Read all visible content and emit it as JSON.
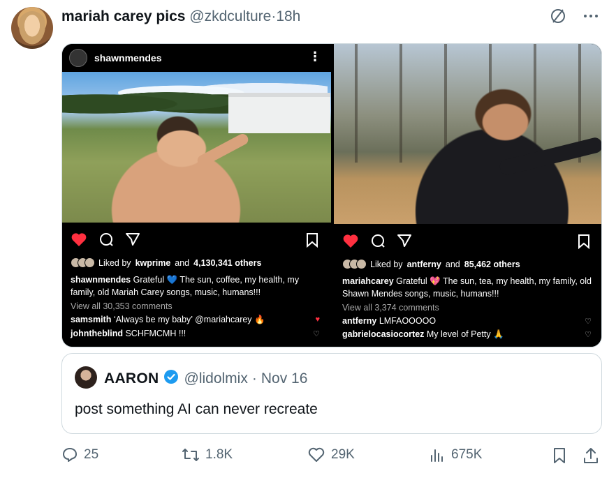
{
  "tweet": {
    "author_name": "mariah carey pics",
    "author_handle": "@zkdculture",
    "separator": "·",
    "time": "18h"
  },
  "left_post": {
    "username": "shawnmendes",
    "likes_prefix": "Liked by",
    "liked_by": "kwprime",
    "likes_mid": "and",
    "likes_count": "4,130,341 others",
    "caption_user": "shawnmendes",
    "caption_text_1": "Grateful",
    "caption_heart": "💙",
    "caption_text_2": "The sun, coffee, my health, my family, old Mariah Carey songs, music, humans!!!",
    "view_all": "View all 30,353 comments",
    "comments": [
      {
        "user": "samsmith",
        "text": "‘Always be my baby’ @mariahcarey 🔥"
      },
      {
        "user": "johntheblind",
        "text": "SCHFMCMH !!!"
      }
    ]
  },
  "right_post": {
    "likes_prefix": "Liked by",
    "liked_by": "antferny",
    "likes_mid": "and",
    "likes_count": "85,462 others",
    "caption_user": "mariahcarey",
    "caption_text_1": "Grateful",
    "caption_heart": "💖",
    "caption_text_2": "The sun, tea, my health, my family, old Shawn Mendes songs, music, humans!!!",
    "view_all": "View all 3,374 comments",
    "comments": [
      {
        "user": "antferny",
        "text": "LMFAOOOOO"
      },
      {
        "user": "gabrielocasiocortez",
        "text": "My level of Petty 🙏"
      }
    ]
  },
  "quote": {
    "name": "AARON",
    "handle": "@lidolmix",
    "separator": "·",
    "date": "Nov 16",
    "text": "post something AI can never recreate"
  },
  "actions": {
    "replies": "25",
    "reposts": "1.8K",
    "likes": "29K",
    "views": "675K"
  },
  "colors": {
    "text_primary": "#0f1419",
    "text_secondary": "#536471",
    "border": "#cfd9de",
    "verified_blue": "#1d9bf0",
    "ig_like_red": "#ff3040"
  },
  "icons": [
    "grok-icon",
    "more-icon",
    "reply-icon",
    "repost-icon",
    "like-icon",
    "views-icon",
    "bookmark-icon",
    "share-icon",
    "verified-icon"
  ]
}
